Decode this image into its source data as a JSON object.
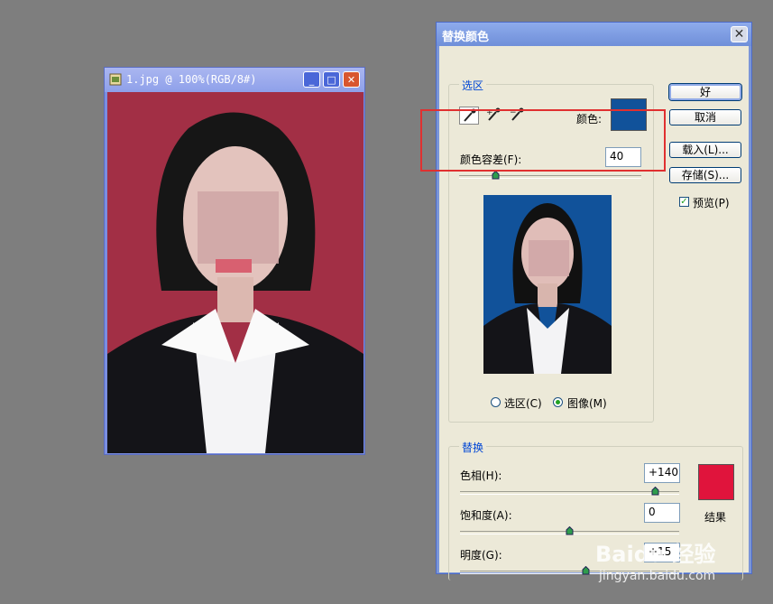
{
  "document": {
    "title": "1.jpg @ 100%(RGB/8#)",
    "background_color": "#a22f45",
    "controls": {
      "minimize": "_",
      "maximize": "□",
      "close": "✕"
    }
  },
  "dialog": {
    "title": "替换颜色",
    "close": "✕",
    "selection": {
      "group_label": "选区",
      "color_label": "颜色:",
      "sample_color": "#11529a",
      "fuzziness_label": "颜色容差(F):",
      "fuzziness_value": "40",
      "fuzziness_level": 0.2,
      "preview_background": "#11529a",
      "radio_selection": "选区(C)",
      "radio_image": "图像(M)",
      "selected_radio": "image"
    },
    "buttons": {
      "ok": "好",
      "cancel": "取消",
      "load": "载入(L)...",
      "save": "存储(S)..."
    },
    "preview_checkbox": {
      "label": "预览(P)",
      "checked": true
    },
    "replace": {
      "group_label": "替换",
      "hue_label": "色相(H):",
      "hue_value": "+140",
      "hue_level": 0.889,
      "saturation_label": "饱和度(A):",
      "saturation_value": "0",
      "saturation_level": 0.5,
      "lightness_label": "明度(G):",
      "lightness_value": "+15",
      "lightness_level": 0.575,
      "result_label": "结果",
      "result_color": "#e0143c"
    }
  },
  "watermark": {
    "brand": "Baidu 经验",
    "url": "jingyan.baidu.com"
  }
}
